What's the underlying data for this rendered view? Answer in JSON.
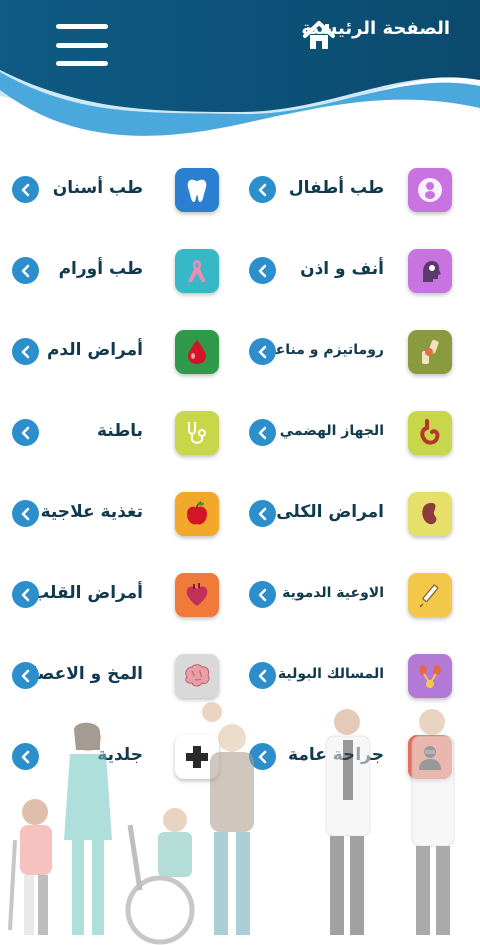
{
  "header": {
    "title": "الصفحة الرئيسية",
    "home_icon": "home-icon",
    "menu_icon": "hamburger-menu-icon",
    "colors": {
      "dark": "#0d4a70",
      "mid": "#1a73a6",
      "light": "#5fb6e6"
    }
  },
  "specialties": {
    "right": [
      {
        "label": "طب أطفال",
        "icon": "baby-icon",
        "color": "#c774e0"
      },
      {
        "label": "أنف و اذن",
        "icon": "ent-head-icon",
        "color": "#c774e0"
      },
      {
        "label": "روماتيزم و مناعة",
        "icon": "knee-joint-icon",
        "color": "#8a9a3e"
      },
      {
        "label": "الجهاز الهضمي",
        "icon": "stomach-icon",
        "color": "#c8d64a"
      },
      {
        "label": "امراض الكلى",
        "icon": "kidney-icon",
        "color": "#e6e06a"
      },
      {
        "label": "الاوعية الدموية",
        "icon": "syringe-icon",
        "color": "#f3c84a"
      },
      {
        "label": "المسالك البولية",
        "icon": "urinary-icon",
        "color": "#b27ad6"
      },
      {
        "label": "جراحة عامة",
        "icon": "surgeon-icon",
        "color": "#e0705a"
      }
    ],
    "left": [
      {
        "label": "طب أسنان",
        "icon": "tooth-icon",
        "color": "#2a7fd0"
      },
      {
        "label": "طب أورام",
        "icon": "ribbon-icon",
        "color": "#37b8c6"
      },
      {
        "label": "أمراض الدم",
        "icon": "blood-drop-icon",
        "color": "#2e9a4a"
      },
      {
        "label": "باطنة",
        "icon": "stethoscope-icon",
        "color": "#c8d64a"
      },
      {
        "label": "تغذية علاجية",
        "icon": "apple-icon",
        "color": "#f2a82a"
      },
      {
        "label": "أمراض القلب",
        "icon": "heart-icon",
        "color": "#f07a3a"
      },
      {
        "label": "المخ و الاعصاب",
        "icon": "brain-icon",
        "color": "#d9d9d9"
      },
      {
        "label": "جلدية",
        "icon": "plus-icon",
        "color": "#ffffff"
      }
    ]
  },
  "chevron_icon": "chevron-left-icon",
  "chevron_color": "#2c8fcc"
}
